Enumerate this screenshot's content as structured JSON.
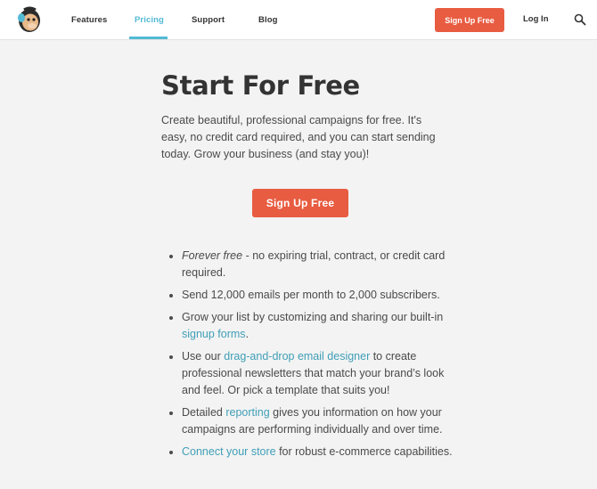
{
  "nav": {
    "features": "Features",
    "pricing": "Pricing",
    "support": "Support",
    "blog": "Blog",
    "signup": "Sign Up Free",
    "login": "Log In",
    "search_icon": "search-icon",
    "logo_icon": "mailchimp-logo-icon"
  },
  "main": {
    "title": "Start For Free",
    "intro": "Create beautiful, professional campaigns for free. It's easy, no credit card required, and you can start sending today. Grow your business (and stay you)!",
    "cta": "Sign Up Free",
    "features": [
      {
        "em": "Forever free",
        "text": " - no expiring trial, contract, or credit card required."
      },
      {
        "text": "Send 12,000 emails per month to 2,000 subscribers."
      },
      {
        "before": "Grow your list by customizing and sharing our built-in ",
        "link": "signup forms",
        "after": "."
      },
      {
        "before": "Use our ",
        "link": "drag-and-drop email designer",
        "after": " to create professional newsletters that match your brand’s look and feel. Or pick a template that suits you!"
      },
      {
        "before": "Detailed ",
        "link": "reporting",
        "after": " gives you information on how your campaigns are performing individually and over time."
      },
      {
        "before": "",
        "link": "Connect your store",
        "after": " for robust e-commerce capabilities."
      }
    ]
  },
  "colors": {
    "accent": "#52bad5",
    "button": "#e85c41",
    "link": "#3f9fb7",
    "background": "#f3f3f3"
  }
}
